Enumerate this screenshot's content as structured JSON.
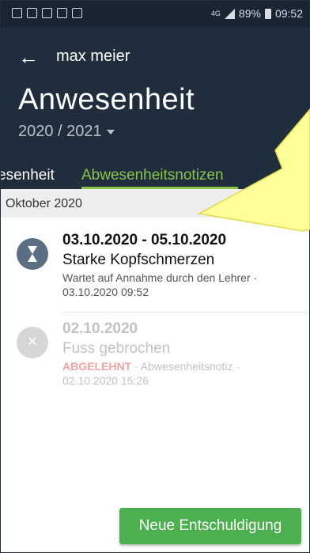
{
  "status_bar": {
    "network": "4G",
    "battery": "89%",
    "time": "09:52"
  },
  "header": {
    "back_icon": "arrow-left-icon",
    "user_name": "max meier",
    "title": "Anwesenheit",
    "school_year": "2020 / 2021"
  },
  "tabs": {
    "items": [
      {
        "label": "esenheit",
        "active": false
      },
      {
        "label": "Abwesenheitsnotizen",
        "active": true
      }
    ]
  },
  "list": {
    "month_header": "Oktober 2020",
    "items": [
      {
        "date": "03.10.2020 - 05.10.2020",
        "description": "Starke Kopfschmerzen",
        "status": "Wartet auf Annahme durch den Lehrer ·",
        "timestamp": "03.10.2020 09:52",
        "icon": "hourglass-icon"
      },
      {
        "date": "02.10.2020",
        "description": "Fuss gebrochen",
        "status": "ABGELEHNT",
        "type": " · Abwesenheitsnotiz ·",
        "timestamp": "02.10.2020 15:26",
        "icon": "close-icon"
      }
    ]
  },
  "actions": {
    "new_excuse": "Neue Entschuldigung"
  },
  "colors": {
    "header_bg": "#1f2d3d",
    "accent": "#8bc34a",
    "button": "#4caf50",
    "callout": "#ffff99"
  }
}
